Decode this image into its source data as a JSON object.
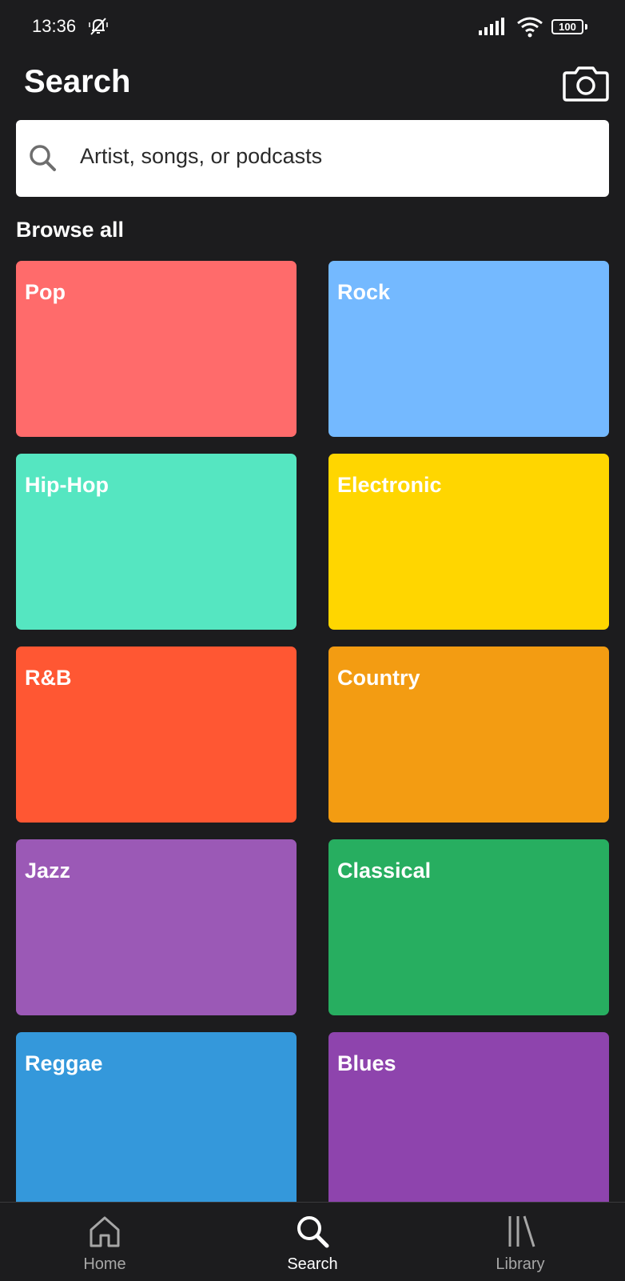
{
  "status_bar": {
    "time": "13:36",
    "battery": "100",
    "icons": [
      "bell-off-icon",
      "signal-icon",
      "wifi-icon",
      "battery-icon"
    ]
  },
  "header": {
    "title": "Search",
    "camera_icon": "camera-icon"
  },
  "search": {
    "placeholder": "Artist, songs, or podcasts",
    "icon": "search-icon"
  },
  "browse": {
    "heading": "Browse all",
    "categories": [
      {
        "label": "Pop",
        "color": "#ff6b6b"
      },
      {
        "label": "Rock",
        "color": "#74b9ff"
      },
      {
        "label": "Hip-Hop",
        "color": "#55e6c1"
      },
      {
        "label": "Electronic",
        "color": "#ffd600"
      },
      {
        "label": "R&B",
        "color": "#ff5733"
      },
      {
        "label": "Country",
        "color": "#f39c12"
      },
      {
        "label": "Jazz",
        "color": "#9b59b6"
      },
      {
        "label": "Classical",
        "color": "#27ae60"
      },
      {
        "label": "Reggae",
        "color": "#3498db"
      },
      {
        "label": "Blues",
        "color": "#8e44ad"
      }
    ]
  },
  "bottom_nav": {
    "items": [
      {
        "label": "Home",
        "icon": "home-icon",
        "active": false
      },
      {
        "label": "Search",
        "icon": "search-icon",
        "active": true
      },
      {
        "label": "Library",
        "icon": "library-icon",
        "active": false
      }
    ],
    "active_color": "#ffffff",
    "inactive_color": "#a7a7a7"
  }
}
